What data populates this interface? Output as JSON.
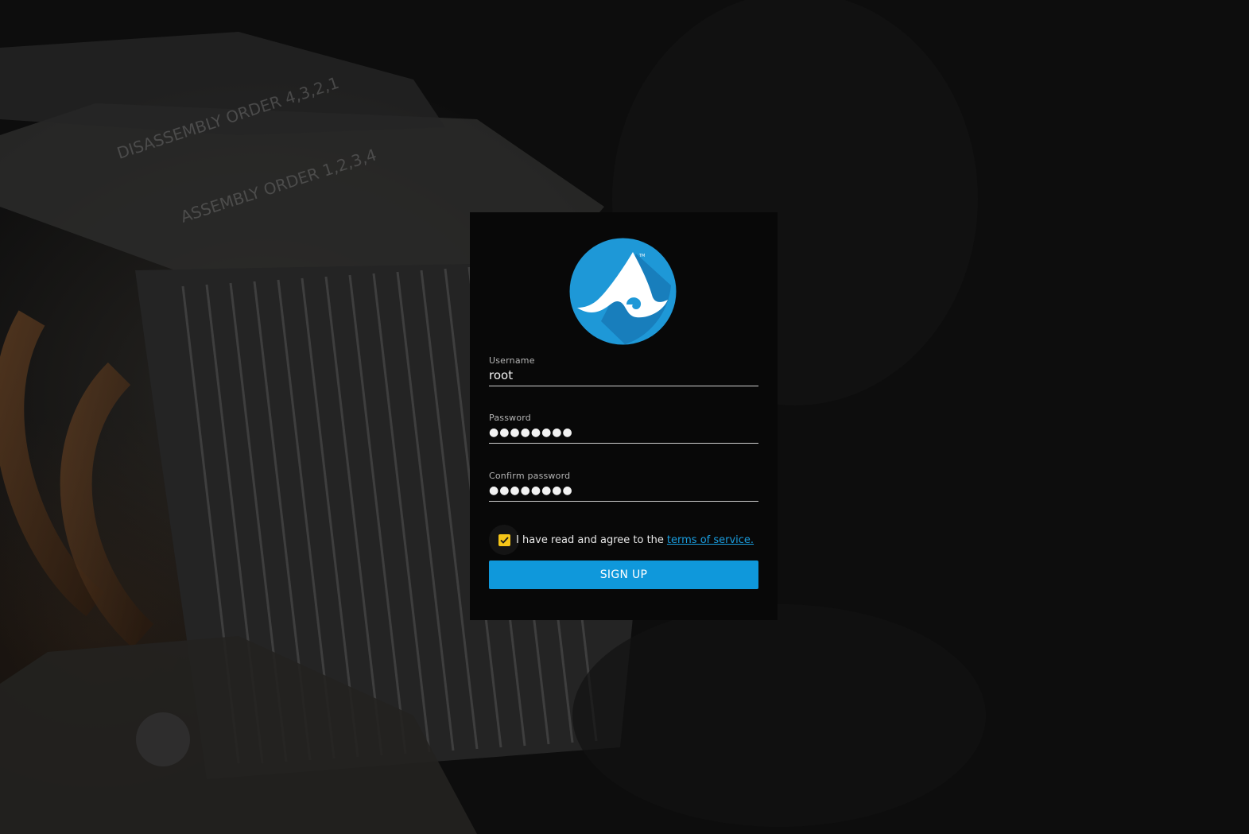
{
  "form": {
    "username_label": "Username",
    "username_value": "root",
    "password_label": "Password",
    "password_value": "●●●●●●●●",
    "confirm_label": "Confirm password",
    "confirm_value": "●●●●●●●●",
    "agree_text": "I have read and agree to the",
    "terms_link": "terms of service.",
    "terms_checked": true,
    "signup_label": "SIGN UP"
  },
  "colors": {
    "accent": "#0f98db",
    "link": "#1a9ee0",
    "checkbox": "#f5c518",
    "logo_blue": "#1e98d7"
  },
  "icons": {
    "logo": "app-logo-icon",
    "check": "checkmark-icon"
  }
}
